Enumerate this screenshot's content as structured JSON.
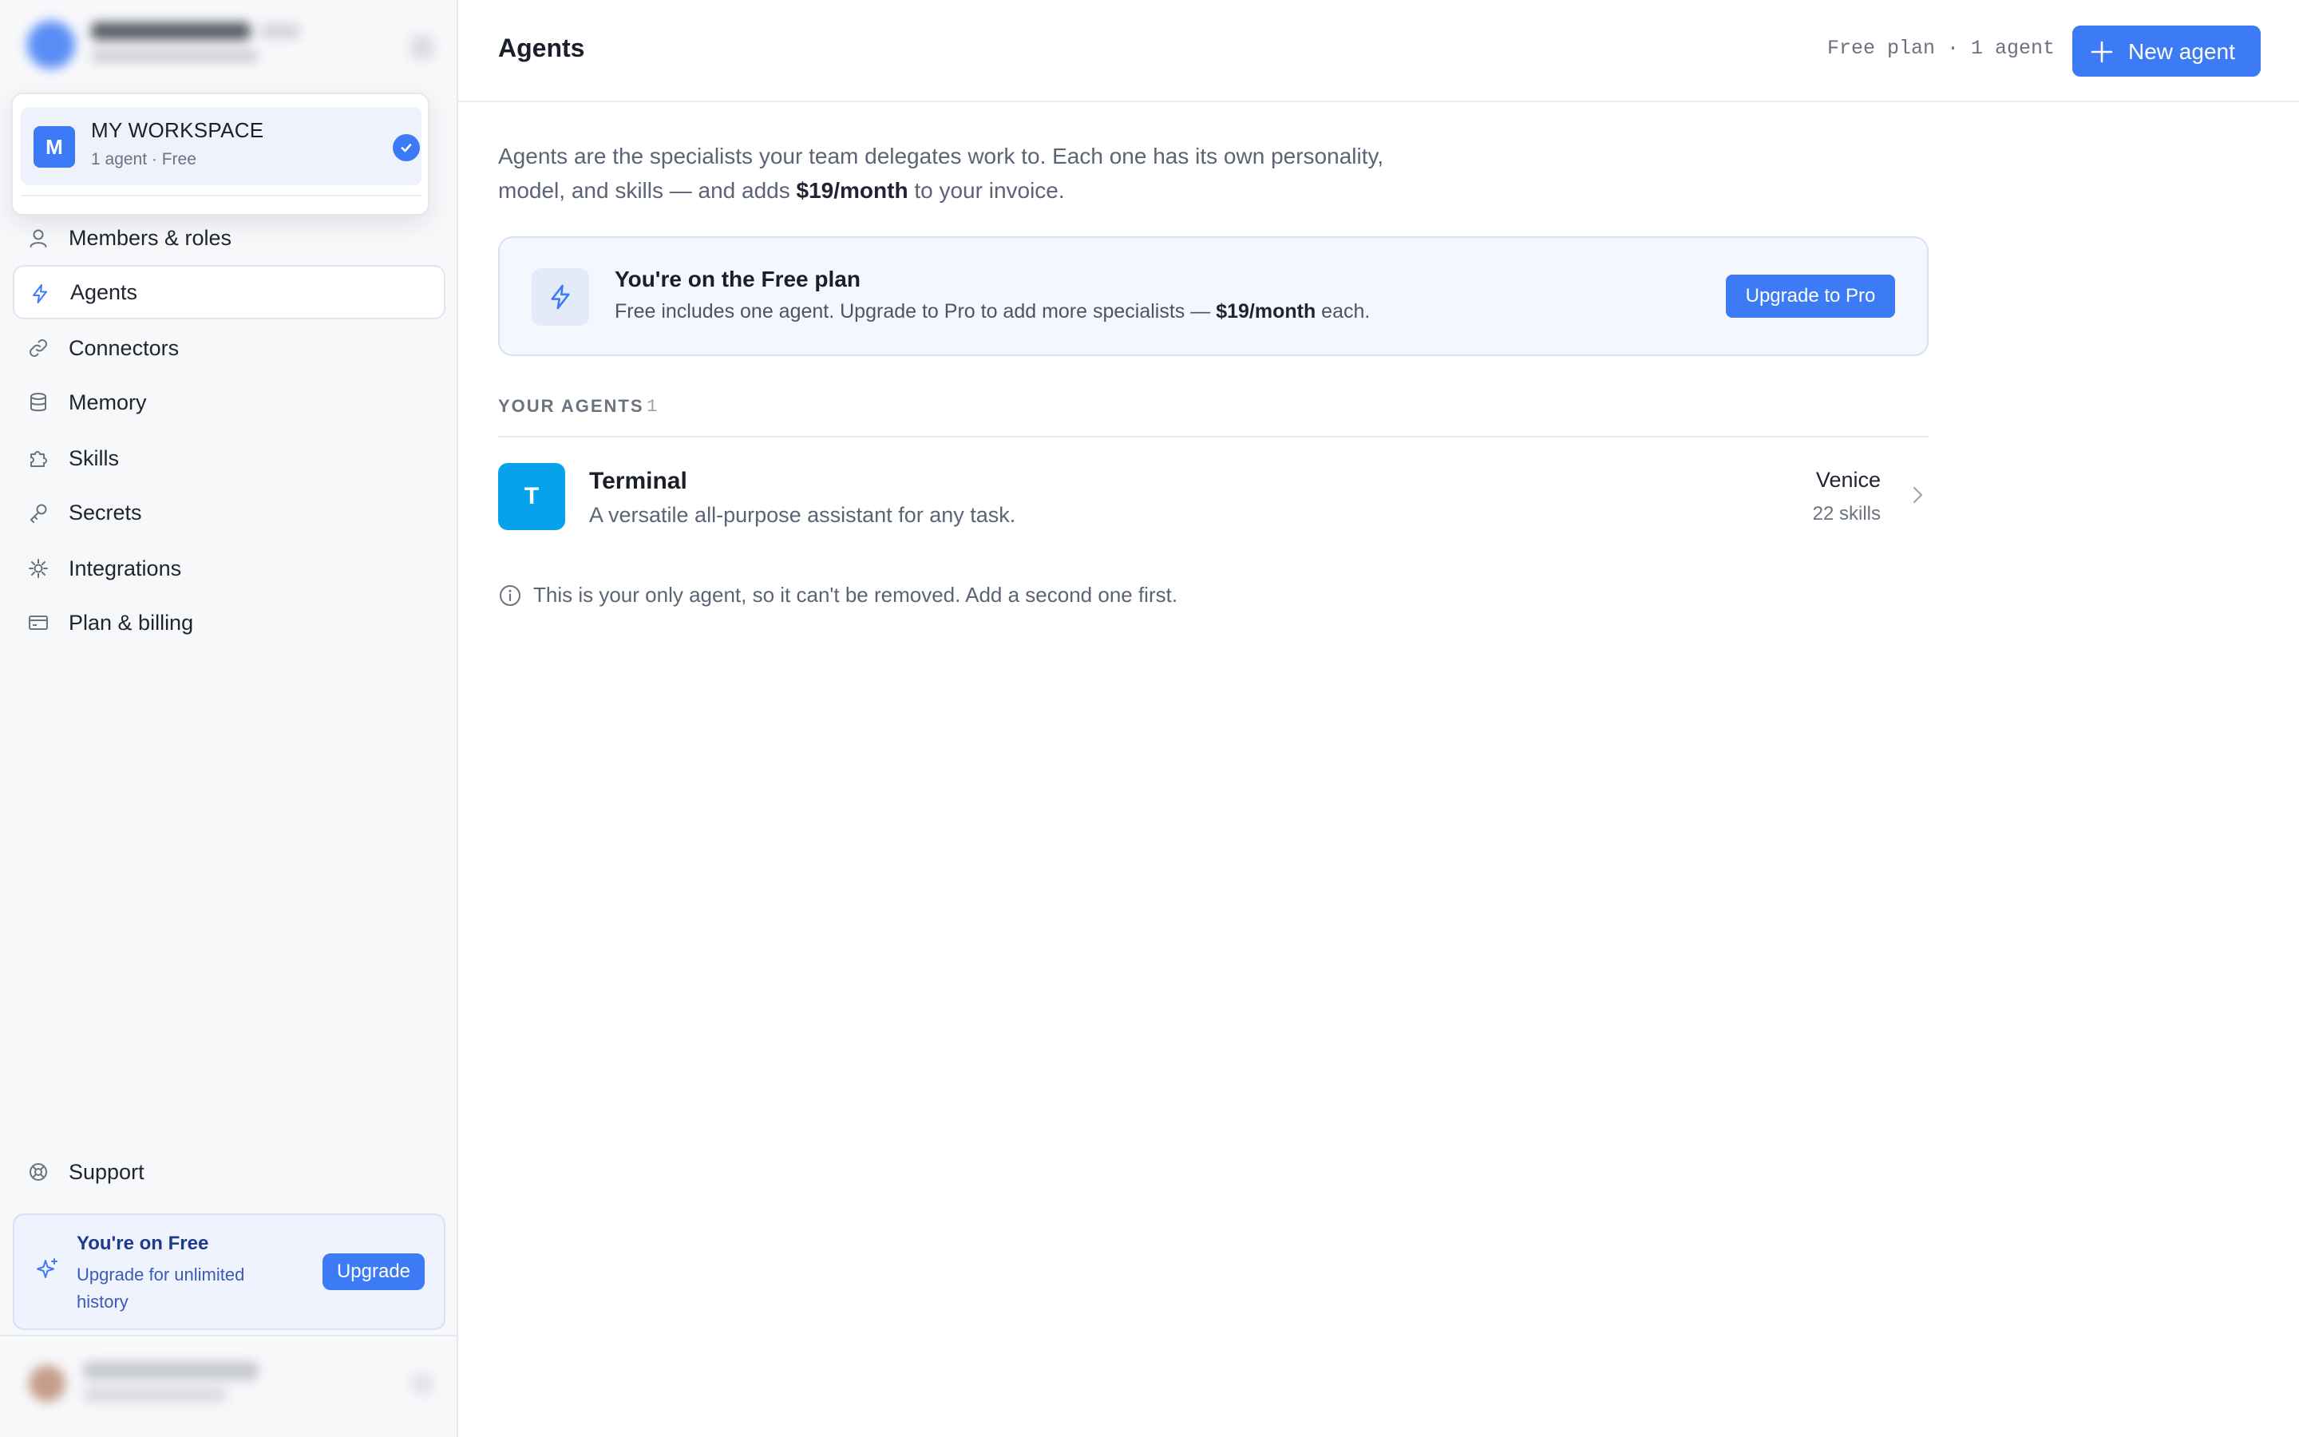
{
  "workspace": {
    "option_name": "MY WORKSPACE",
    "option_avatar": "M",
    "option_meta": "1 agent · Free",
    "selected": true
  },
  "sidebar": {
    "items": [
      {
        "label": "Members & roles",
        "icon": "user-icon"
      },
      {
        "label": "Agents",
        "icon": "lightning-icon",
        "active": true
      },
      {
        "label": "Connectors",
        "icon": "link-icon"
      },
      {
        "label": "Memory",
        "icon": "database-icon"
      },
      {
        "label": "Skills",
        "icon": "puzzle-icon"
      },
      {
        "label": "Secrets",
        "icon": "key-icon"
      },
      {
        "label": "Integrations",
        "icon": "plug-icon"
      },
      {
        "label": "Plan & billing",
        "icon": "credit-card-icon"
      }
    ],
    "support_label": "Support",
    "upgrade_card": {
      "title": "You're on Free",
      "text": "Upgrade for unlimited history",
      "button": "Upgrade"
    }
  },
  "header": {
    "title": "Agents",
    "plan_summary": "Free plan · 1 agent",
    "new_agent_label": "New agent"
  },
  "intro": {
    "text_before": "Agents are the specialists your team delegates work to. Each one has its own personality, model, and skills — and adds ",
    "price": "$19/month",
    "text_after": " to your invoice."
  },
  "plan_banner": {
    "title": "You're on the Free plan",
    "text_before": "Free includes one agent. Upgrade to Pro to add more specialists — ",
    "price": "$19/month",
    "text_after": " each.",
    "button": "Upgrade to Pro"
  },
  "agents_section": {
    "label": "YOUR AGENTS",
    "count": "1",
    "agents": [
      {
        "avatar": "T",
        "name": "Terminal",
        "description": "A versatile all-purpose assistant for any task.",
        "model": "Venice",
        "skills": "22 skills"
      }
    ],
    "note": "This is your only agent, so it can't be removed. Add a second one first."
  },
  "colors": {
    "accent": "#3d7bf6",
    "agent_avatar": "#06a3ea",
    "sidebar_bg": "#f7f8fa",
    "banner_bg": "#f4f7fd"
  }
}
